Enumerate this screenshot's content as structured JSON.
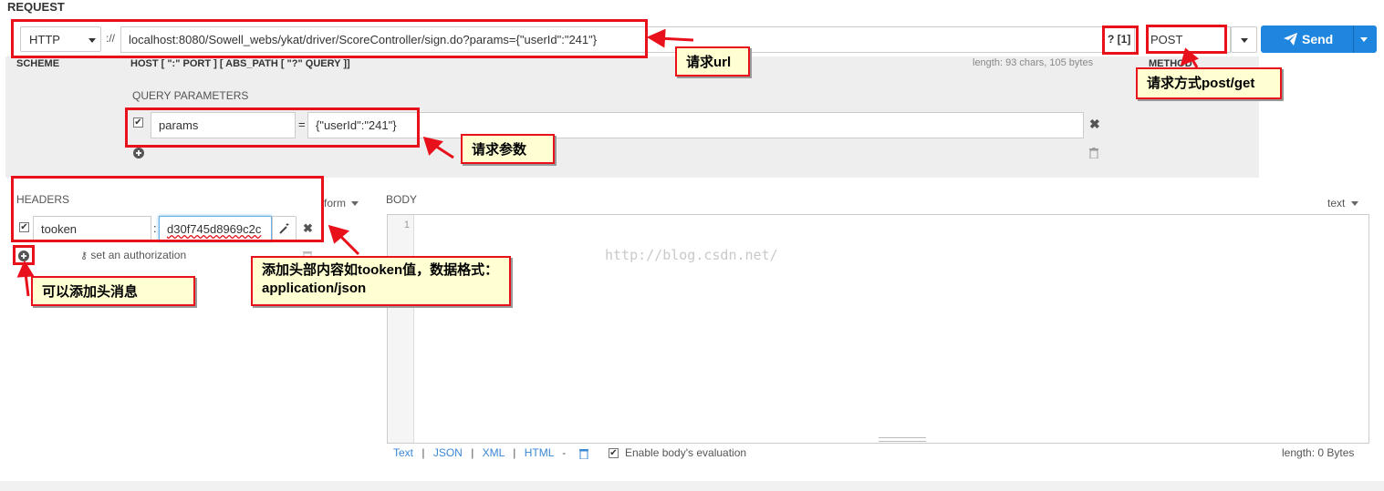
{
  "section_title": "REQUEST",
  "scheme": {
    "value": "HTTP",
    "label": "SCHEME",
    "separator": "://"
  },
  "url": {
    "value": "localhost:8080/Sowell_webs/ykat/driver/ScoreController/sign.do?params={\"userId\":\"241\"}",
    "host_label": "HOST [ \":\" PORT ] [ ABS_PATH [ \"?\" QUERY ]]",
    "length_info": "length: 93 chars, 105 bytes",
    "query_badge": "? [1]"
  },
  "method": {
    "value": "POST",
    "label": "METHOD"
  },
  "send_button": {
    "label": "Send"
  },
  "query_parameters": {
    "title": "QUERY PARAMETERS",
    "rows": [
      {
        "name": "params",
        "equals": "=",
        "value": "{\"userId\":\"241\"}"
      }
    ]
  },
  "headers": {
    "title": "HEADERS",
    "form_toggle": "form",
    "rows": [
      {
        "name": "tooken",
        "separator": ":",
        "value": "d30f745d8969c2c"
      }
    ],
    "authorization_link": "set an authorization"
  },
  "body": {
    "title": "BODY",
    "format_toggle": "text",
    "line_number": "1",
    "watermark": "http://blog.csdn.net/",
    "formats": [
      "Text",
      "JSON",
      "XML",
      "HTML"
    ],
    "format_separators": [
      "|",
      "|",
      "|",
      "-"
    ],
    "evaluation_label": "Enable body's evaluation",
    "length": "length: 0 Bytes"
  },
  "annotations": {
    "url": "请求url",
    "method": "请求方式post/get",
    "params": "请求参数",
    "headers_content": "添加头部内容如tooken值，数据格式：application/json",
    "add_header": "可以添加头消息"
  },
  "colors": {
    "annotation_red": "#e8101a",
    "callout_bg": "#ffffd2",
    "send_blue": "#1f86e0",
    "link_blue": "#3a87d6"
  }
}
